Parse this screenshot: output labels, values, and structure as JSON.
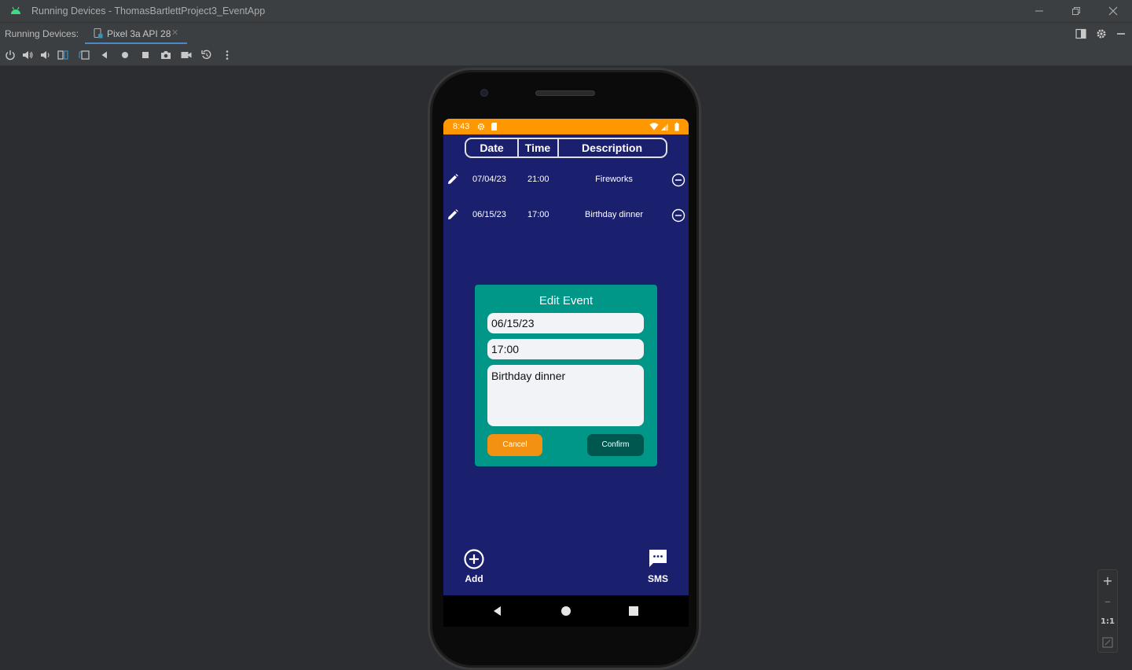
{
  "window": {
    "title": "Running Devices - ThomasBartlettProject3_EventApp"
  },
  "tabs": {
    "label": "Running Devices:",
    "active_tab": "Pixel 3a API 28"
  },
  "zoom": {
    "plus": "+",
    "minus": "–",
    "one_to_one": "1:1"
  },
  "statusbar": {
    "time": "8:43"
  },
  "table_header": {
    "columns": [
      "Date",
      "Time",
      "Description"
    ]
  },
  "events": [
    {
      "date": "07/04/23",
      "time": "21:00",
      "description": "Fireworks"
    },
    {
      "date": "06/15/23",
      "time": "17:00",
      "description": "Birthday dinner"
    }
  ],
  "dialog": {
    "title": "Edit Event",
    "date_value": "06/15/23",
    "time_value": "17:00",
    "description_value": "Birthday dinner",
    "cancel_label": "Cancel",
    "confirm_label": "Confirm"
  },
  "bottom_actions": {
    "add_label": "Add",
    "sms_label": "SMS"
  },
  "colors": {
    "app_background": "#1a1f6e",
    "status_bar": "#ff9800",
    "dialog": "#009688",
    "cancel_button": "#f39212",
    "confirm_button": "#00574f",
    "ide_accent": "#4a88c7"
  }
}
